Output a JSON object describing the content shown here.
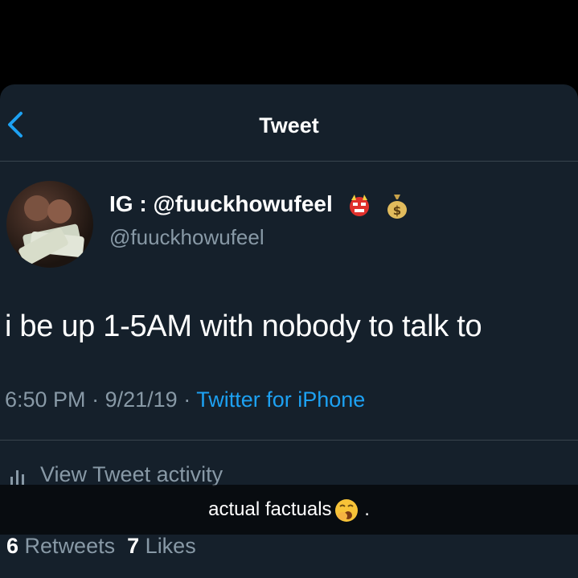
{
  "header": {
    "title": "Tweet"
  },
  "user": {
    "display_name": "IG : @fuuckhowufeel",
    "handle": "@fuuckhowufeel"
  },
  "tweet": {
    "text": "i be up 1-5AM with nobody to talk to",
    "time": "6:50 PM",
    "date": "9/21/19",
    "source": "Twitter for iPhone"
  },
  "activity": {
    "label": "View Tweet activity"
  },
  "counts": {
    "retweets": "6",
    "retweets_label": "Retweets",
    "likes": "7",
    "likes_label": "Likes"
  },
  "caption": {
    "text": "actual factuals",
    "trailing": " ."
  },
  "colors": {
    "background": "#15202b",
    "accent": "#1da1f2",
    "muted": "#8899a6"
  },
  "icons": [
    "back-chevron-icon",
    "japanese-goblin-emoji-icon",
    "money-bag-emoji-icon",
    "stats-bars-icon",
    "yawning-face-emoji-icon"
  ]
}
